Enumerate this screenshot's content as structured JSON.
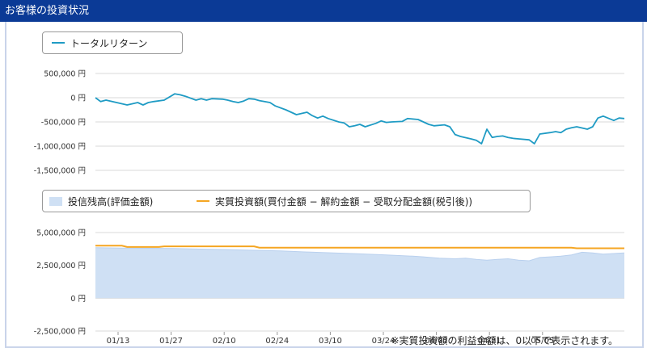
{
  "header": {
    "title": "お客様の投資状況"
  },
  "footnote": "※実質投資額の利益金額は、0以下で表示されます。",
  "colors": {
    "header_bg": "#0b3a96",
    "total_return": "#1f9bc4",
    "balance_fill": "#cfe0f4",
    "invested_line": "#f5a623"
  },
  "chart_data": [
    {
      "type": "line",
      "legend": [
        "トータルリターン"
      ],
      "x_ticks": [],
      "yticks": [
        500000,
        0,
        -500000,
        -1000000,
        -1500000
      ],
      "ytick_labels": [
        "500,000 円",
        "0 円",
        "-500,000 円",
        "-1,000,000 円",
        "-1,500,000 円"
      ],
      "ylim": [
        -1500000,
        500000
      ],
      "xlim": [
        0,
        100
      ],
      "series": [
        {
          "name": "トータルリターン",
          "x": [
            0,
            1,
            2,
            4,
            6,
            8,
            9,
            10,
            11,
            13,
            15,
            16,
            17,
            19,
            20,
            21,
            22,
            24,
            25,
            26,
            27,
            28,
            29,
            30,
            31,
            33,
            34,
            36,
            37,
            38,
            40,
            41,
            42,
            43,
            44,
            46,
            47,
            48,
            49,
            50,
            51,
            53,
            54,
            55,
            56,
            58,
            59,
            61,
            62,
            63,
            64,
            66,
            67,
            68,
            69,
            71,
            72,
            73,
            74,
            75,
            76,
            77,
            78,
            79,
            80,
            82,
            83,
            84,
            86,
            87,
            88,
            89,
            90,
            91,
            93,
            94,
            95,
            96,
            98,
            99,
            100
          ],
          "y": [
            0,
            -80000,
            -50000,
            -100000,
            -150000,
            -100000,
            -150000,
            -100000,
            -80000,
            -50000,
            80000,
            60000,
            30000,
            -50000,
            -20000,
            -50000,
            -20000,
            -30000,
            -50000,
            -80000,
            -100000,
            -70000,
            -20000,
            -30000,
            -60000,
            -100000,
            -170000,
            -250000,
            -300000,
            -350000,
            -300000,
            -370000,
            -420000,
            -380000,
            -430000,
            -500000,
            -520000,
            -600000,
            -580000,
            -550000,
            -600000,
            -530000,
            -480000,
            -510000,
            -500000,
            -490000,
            -430000,
            -450000,
            -500000,
            -550000,
            -580000,
            -560000,
            -600000,
            -760000,
            -800000,
            -850000,
            -880000,
            -950000,
            -650000,
            -820000,
            -800000,
            -790000,
            -820000,
            -840000,
            -850000,
            -870000,
            -950000,
            -750000,
            -720000,
            -700000,
            -720000,
            -650000,
            -620000,
            -600000,
            -650000,
            -600000,
            -420000,
            -380000,
            -470000,
            -420000,
            -430000
          ]
        }
      ]
    },
    {
      "type": "area",
      "legend": [
        "投信残高(評価金額)",
        "実質投資額(買付金額 − 解約金額 − 受取分配金額(税引後))"
      ],
      "x_ticks": [
        "01/13",
        "01/27",
        "02/10",
        "02/24",
        "03/10",
        "03/24",
        "04/07",
        "04/21",
        "05/05"
      ],
      "yticks": [
        5000000,
        2500000,
        0,
        -2500000
      ],
      "ytick_labels": [
        "5,000,000 円",
        "2,500,000 円",
        "0 円",
        "-2,500,000 円"
      ],
      "ylim": [
        -2500000,
        5000000
      ],
      "xlim": [
        0,
        100
      ],
      "series": [
        {
          "name": "投信残高(評価金額)",
          "x": [
            0,
            5,
            10,
            15,
            20,
            25,
            30,
            35,
            40,
            45,
            50,
            55,
            60,
            62,
            65,
            68,
            70,
            72,
            74,
            76,
            78,
            80,
            82,
            84,
            86,
            88,
            90,
            92,
            94,
            96,
            98,
            100
          ],
          "y": [
            3850000,
            3820000,
            3800000,
            3780000,
            3740000,
            3700000,
            3650000,
            3600000,
            3520000,
            3450000,
            3380000,
            3300000,
            3200000,
            3150000,
            3050000,
            3000000,
            3050000,
            2950000,
            2900000,
            2950000,
            3000000,
            2900000,
            2850000,
            3100000,
            3150000,
            3200000,
            3300000,
            3500000,
            3450000,
            3350000,
            3400000,
            3450000
          ]
        },
        {
          "name": "実質投資額(買付金額 − 解約金額 − 受取分配金額(税引後))",
          "x": [
            0,
            5,
            6,
            12,
            13,
            30,
            31,
            90,
            91,
            100
          ],
          "y": [
            4000000,
            4000000,
            3900000,
            3900000,
            3950000,
            3950000,
            3850000,
            3850000,
            3800000,
            3800000
          ]
        }
      ]
    }
  ]
}
